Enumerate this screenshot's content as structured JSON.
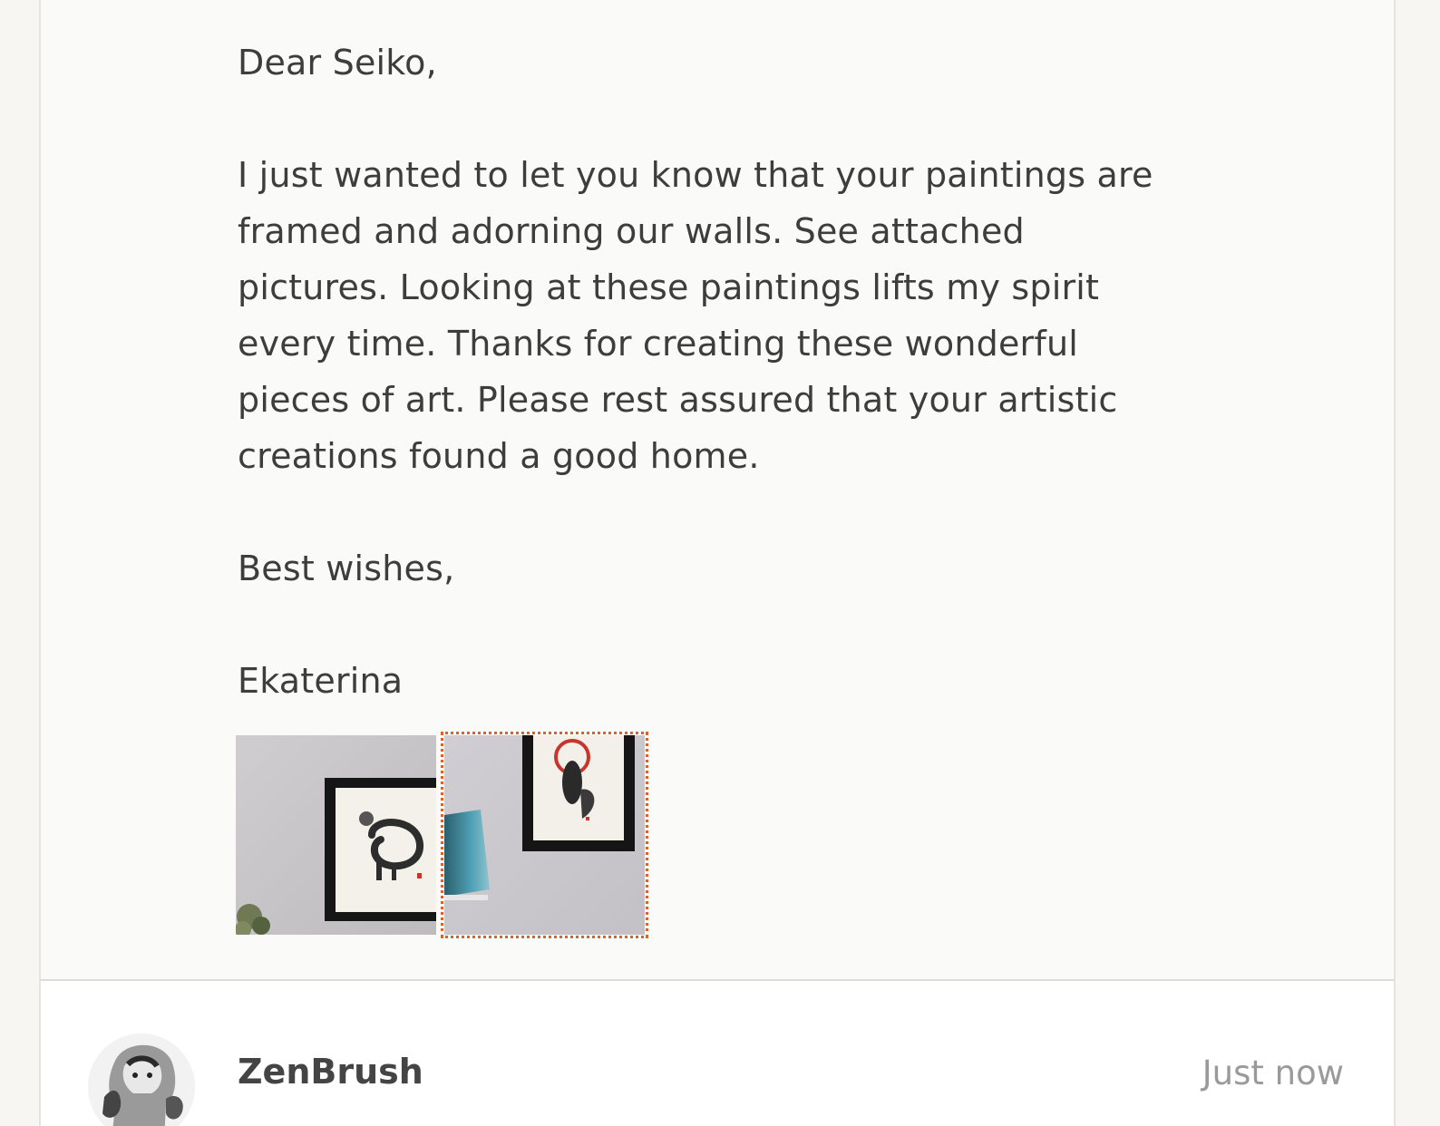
{
  "message": {
    "greeting": "Dear Seiko,",
    "body_lines": [
      "I just wanted to let you know that your paintings are",
      "framed and adorning our walls. See attached",
      "pictures. Looking at these paintings lifts my spirit",
      "every time. Thanks for creating these wonderful",
      "pieces of art. Please rest assured that your artistic",
      "creations found a good home."
    ],
    "closing": "Best wishes,",
    "signature": "Ekaterina"
  },
  "attachments": [
    {
      "icon": "framed-enso-painting-photo"
    },
    {
      "icon": "framed-figure-painting-photo",
      "focused": true
    }
  ],
  "reply": {
    "sender": "ZenBrush",
    "timestamp": "Just now",
    "avatar_icon": "ink-portrait-avatar"
  },
  "colors": {
    "focus_outline": "#d9632b",
    "text": "#3d3d3d",
    "timestamp": "#9a9a9a",
    "background": "#fafaf8"
  }
}
